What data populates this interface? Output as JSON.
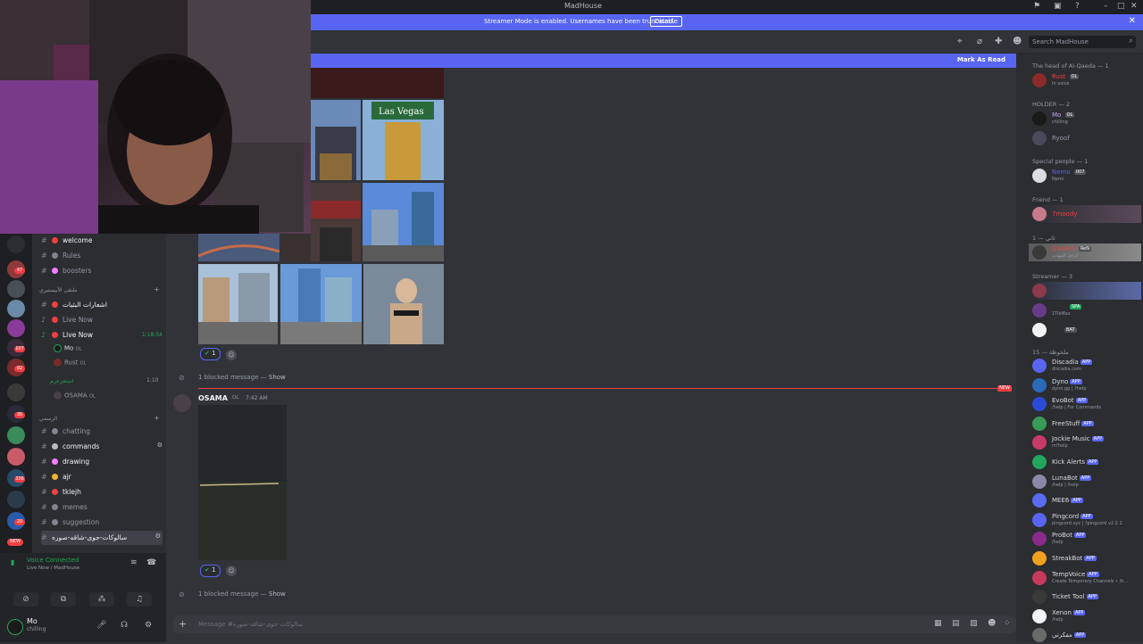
{
  "titlebar": {
    "title": "MadHouse"
  },
  "banner": {
    "text": "Streamer Mode is enabled. Usernames have been truncated.",
    "button": "Disable"
  },
  "header": {
    "search_placeholder": "Search MadHouse"
  },
  "unread": {
    "mark_as_read": "Mark As Read"
  },
  "server_badges": [
    "47",
    "107",
    "82",
    "35",
    "336",
    "20",
    "NEW"
  ],
  "channels": {
    "items": [
      {
        "label": "welcome",
        "color": "#f23f43"
      },
      {
        "label": "Rules",
        "color": "#80848e"
      },
      {
        "label": "boosters",
        "color": "#f47fff"
      }
    ],
    "cat1": "ملتقى الأبيستيري",
    "voice1": "اشعارات البثيات",
    "live1": "Live Now",
    "live2": "Live Now",
    "live2_time": "1:18:54",
    "voice_users": [
      {
        "name": "Mo",
        "tag": "OL"
      },
      {
        "name": "Rust",
        "tag": "OL"
      }
    ],
    "cat2": "استجرجرم",
    "cat2_time": "1:10",
    "osama": {
      "name": "OSAMA",
      "tag": "OL"
    },
    "cat3": "الرسمي",
    "text_channels": [
      {
        "label": "chatting",
        "color": "#80848e"
      },
      {
        "label": "commands",
        "color": "#b5bac1"
      },
      {
        "label": "drawing",
        "color": "#f47fff"
      },
      {
        "label": "ajr",
        "color": "#f0b232"
      },
      {
        "label": "tklejh",
        "color": "#ed4245"
      },
      {
        "label": "memes",
        "color": "#80848e"
      },
      {
        "label": "suggestion",
        "color": "#80848e"
      },
      {
        "label": "سالوكات-جوى-شاقه-صوره",
        "color": "#80848e"
      }
    ]
  },
  "voice_panel": {
    "status": "Voice Connected",
    "channel": "Live Now / MadHouse"
  },
  "user_panel": {
    "name": "Mo",
    "status": "chilling"
  },
  "chat": {
    "reaction_count": "1",
    "blocked_text": "1 blocked message",
    "blocked_show": "Show",
    "author": "OSAMA",
    "author_tag": "OL",
    "time": "7:42 AM",
    "new_label": "NEW",
    "composer_placeholder": "Message #سالوكات-جوى-شاقه-صوره"
  },
  "members": {
    "groups": [
      {
        "label": "The head of Al-Qaeda — 1"
      },
      {
        "label": "HOLDER — 2"
      },
      {
        "label": "Special people — 1"
      },
      {
        "label": "Friend — 1"
      },
      {
        "label": "ثاني — 1"
      },
      {
        "label": "Streamer — 3"
      },
      {
        "label": "ملحوظة — 15"
      }
    ],
    "head": {
      "name": "Rust",
      "tag": "OL",
      "status": "In voice"
    },
    "holder": [
      {
        "name": "Mo",
        "tag": "OL",
        "status": "chilling"
      },
      {
        "name": "Ryoof",
        "tag": "",
        "status": ""
      }
    ],
    "special": {
      "name": "Nemo",
      "tag": "007",
      "status": "Nemi"
    },
    "friend": {
      "name": "7moody",
      "tag": "",
      "status": ""
    },
    "thani": {
      "name": "OSAMA",
      "tag": "ReN",
      "status": "الرجل المهذب"
    },
    "streamers": [
      {
        "name": "",
        "tag": "SPA",
        "status": "1TikMax"
      },
      {
        "name": "",
        "tag": "BAT",
        "status": ""
      }
    ],
    "app_label": "APP",
    "bots": [
      {
        "name": "Discadia",
        "status": "discadia.com"
      },
      {
        "name": "Dyno",
        "status": "dyno.gg | ?help"
      },
      {
        "name": "EvoBot",
        "status": "/help | For Commands"
      },
      {
        "name": "FreeStuff",
        "status": ""
      },
      {
        "name": "Jockie Music",
        "status": "m!help"
      },
      {
        "name": "Kick Alerts",
        "status": ""
      },
      {
        "name": "LunaBot",
        "status": "/help | /help"
      },
      {
        "name": "MEE6",
        "status": ""
      },
      {
        "name": "Pingcord",
        "status": "pingcord.xyz | ?pingcord v2.2.1"
      },
      {
        "name": "ProBot",
        "status": "/help"
      },
      {
        "name": "StreakBot",
        "status": ""
      },
      {
        "name": "TempVoice",
        "status": "Create Temporary Channels • /h..."
      },
      {
        "name": "Ticket Tool",
        "status": ""
      },
      {
        "name": "Xenon",
        "status": "/help"
      },
      {
        "name": "مفكرتي",
        "status": ""
      }
    ]
  }
}
